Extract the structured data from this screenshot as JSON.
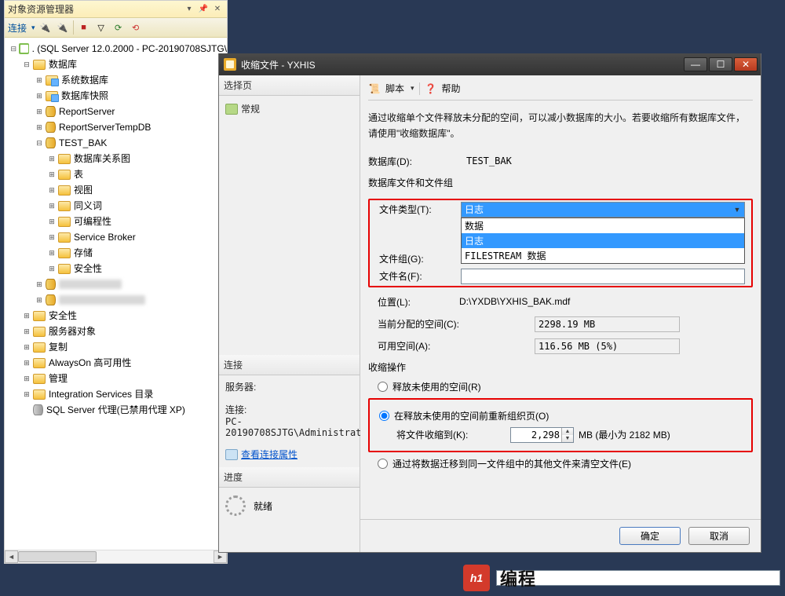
{
  "explorer": {
    "title": "对象资源管理器",
    "toolbar": {
      "connect": "连接"
    },
    "tree": {
      "root": ". (SQL Server 12.0.2000 - PC-20190708SJTG\\",
      "databases": "数据库",
      "systemdb": "系统数据库",
      "snapshots": "数据库快照",
      "reportserver": "ReportServer",
      "reportservertemp": "ReportServerTempDB",
      "testbak": "TEST_BAK",
      "diagrams": "数据库关系图",
      "tables": "表",
      "views": "视图",
      "synonyms": "同义词",
      "programmability": "可编程性",
      "servicebroker": "Service Broker",
      "storage": "存储",
      "security_db": "安全性",
      "security": "安全性",
      "serverobj": "服务器对象",
      "replication": "复制",
      "alwayson": "AlwaysOn 高可用性",
      "management": "管理",
      "integration": "Integration Services 目录",
      "sqlagent": "SQL Server 代理(已禁用代理 XP)"
    }
  },
  "dialog": {
    "title": "收缩文件 - YXHIS",
    "left": {
      "selectpage": "选择页",
      "general": "常规",
      "connection": "连接",
      "server_label": "服务器:",
      "connection_label": "连接:",
      "connection_value": "PC-20190708SJTG\\Administrat",
      "view_props": "查看连接属性",
      "progress_title": "进度",
      "ready": "就绪"
    },
    "right": {
      "script": "脚本",
      "help": "帮助",
      "desc": "通过收缩单个文件释放未分配的空间，可以减小数据库的大小。若要收缩所有数据库文件，请使用\"收缩数据库\"。",
      "db_label": "数据库(D):",
      "db_value": "TEST_BAK",
      "group_title": "数据库文件和文件组",
      "filetype_label": "文件类型(T):",
      "filetype_value": "日志",
      "filetype_options": [
        "数据",
        "日志",
        "FILESTREAM 数据"
      ],
      "filegroup_label": "文件组(G):",
      "filename_label": "文件名(F):",
      "location_label": "位置(L):",
      "location_value": "D:\\YXDB\\YXHIS_BAK.mdf",
      "alloc_label": "当前分配的空间(C):",
      "alloc_value": "2298.19 MB",
      "avail_label": "可用空间(A):",
      "avail_value": "116.56 MB (5%)",
      "shrink_title": "收缩操作",
      "opt_release": "释放未使用的空间(R)",
      "opt_reorg": "在释放未使用的空间前重新组织页(O)",
      "shrink_to_label": "将文件收缩到(K):",
      "shrink_to_value": "2,298",
      "shrink_to_unit": "MB (最小为 2182 MB)",
      "opt_empty": "通过将数据迁移到同一文件组中的其他文件来清空文件(E)",
      "ok": "确定",
      "cancel": "取消"
    }
  },
  "logo": {
    "mark": "h1",
    "text": "编程"
  }
}
